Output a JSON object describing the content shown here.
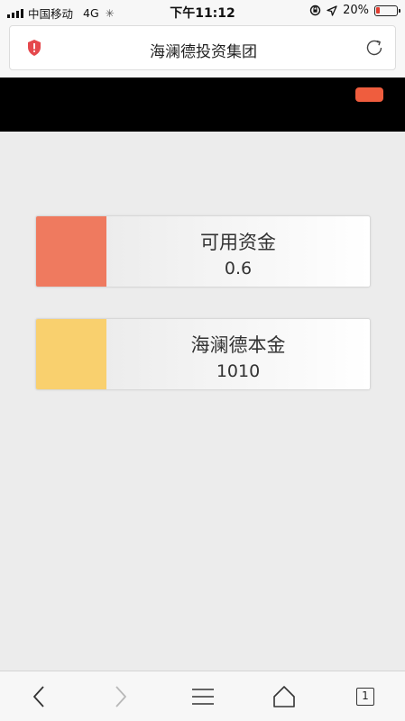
{
  "status_bar": {
    "carrier": "中国移动",
    "network": "4G",
    "time": "下午11:12",
    "battery": "20%",
    "battery_level": 0.2
  },
  "browser": {
    "title": "海澜德投资集团",
    "tab_count": "1",
    "icons": [
      "shield-icon",
      "reload-icon",
      "back-icon",
      "forward-icon",
      "menu-icon",
      "home-icon",
      "tabs-icon"
    ]
  },
  "cards": [
    {
      "label": "可用资金",
      "value": "0.6",
      "color": "#ef7a5f"
    },
    {
      "label": "海澜德本金",
      "value": "1010",
      "color": "#f9d06e"
    }
  ],
  "colors": {
    "header_bg": "#000000",
    "accent": "#ef5d3e",
    "battery": "#e03c2f"
  }
}
